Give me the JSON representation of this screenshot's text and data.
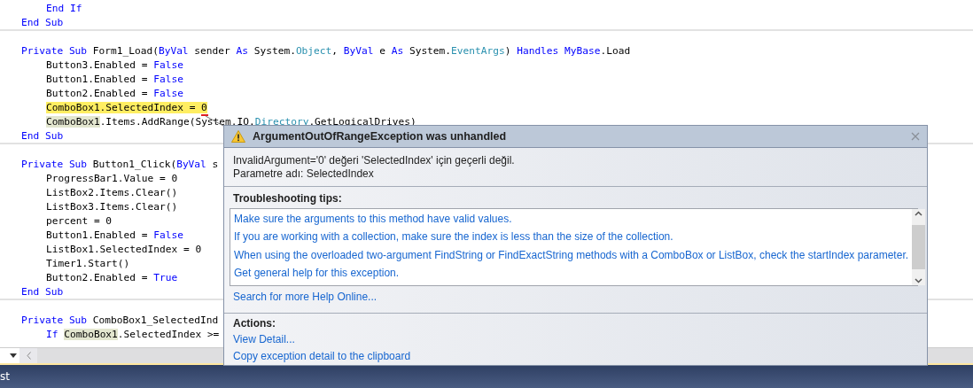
{
  "editor": {
    "lines": [
      {
        "kind": "code",
        "indented": true,
        "separator": false,
        "tokens": [
          {
            "text": "End If",
            "kind": "keyword"
          }
        ]
      },
      {
        "kind": "code",
        "indented": false,
        "separator": true,
        "tokens": [
          {
            "text": "End Sub",
            "kind": "keyword"
          }
        ]
      },
      {
        "kind": "blank"
      },
      {
        "kind": "code",
        "indented": false,
        "separator": false,
        "tokens": [
          {
            "text": "Private Sub",
            "kind": "keyword"
          },
          {
            "text": " Form1_Load(",
            "kind": "plain"
          },
          {
            "text": "ByVal",
            "kind": "keyword"
          },
          {
            "text": " sender ",
            "kind": "plain"
          },
          {
            "text": "As",
            "kind": "keyword"
          },
          {
            "text": " System.",
            "kind": "plain"
          },
          {
            "text": "Object",
            "kind": "type"
          },
          {
            "text": ", ",
            "kind": "plain"
          },
          {
            "text": "ByVal",
            "kind": "keyword"
          },
          {
            "text": " e ",
            "kind": "plain"
          },
          {
            "text": "As",
            "kind": "keyword"
          },
          {
            "text": " System.",
            "kind": "plain"
          },
          {
            "text": "EventArgs",
            "kind": "type"
          },
          {
            "text": ") ",
            "kind": "plain"
          },
          {
            "text": "Handles MyBase",
            "kind": "keyword"
          },
          {
            "text": ".Load",
            "kind": "plain"
          }
        ]
      },
      {
        "kind": "code",
        "indented": true,
        "separator": false,
        "tokens": [
          {
            "text": "Button3.Enabled = ",
            "kind": "plain"
          },
          {
            "text": "False",
            "kind": "keyword"
          }
        ]
      },
      {
        "kind": "code",
        "indented": true,
        "separator": false,
        "tokens": [
          {
            "text": "Button1.Enabled = ",
            "kind": "plain"
          },
          {
            "text": "False",
            "kind": "keyword"
          }
        ]
      },
      {
        "kind": "code",
        "indented": true,
        "separator": false,
        "tokens": [
          {
            "text": "Button2.Enabled = ",
            "kind": "plain"
          },
          {
            "text": "False",
            "kind": "keyword"
          }
        ]
      },
      {
        "kind": "code",
        "indented": true,
        "separator": false,
        "tokens": [
          {
            "text": "ComboBox1.SelectedIndex = 0",
            "kind": "current"
          }
        ]
      },
      {
        "kind": "code",
        "indented": true,
        "separator": false,
        "tokens": [
          {
            "text": "ComboBox1",
            "kind": "reference"
          },
          {
            "text": ".Items.AddRange(System.IO.",
            "kind": "plain"
          },
          {
            "text": "Directory",
            "kind": "type"
          },
          {
            "text": ".GetLogicalDrives)",
            "kind": "plain"
          }
        ]
      },
      {
        "kind": "code",
        "indented": false,
        "separator": true,
        "tokens": [
          {
            "text": "End Sub",
            "kind": "keyword"
          }
        ]
      },
      {
        "kind": "blank"
      },
      {
        "kind": "code",
        "indented": false,
        "separator": false,
        "tokens": [
          {
            "text": "Private Sub",
            "kind": "keyword"
          },
          {
            "text": " Button1_Click(",
            "kind": "plain"
          },
          {
            "text": "ByVal",
            "kind": "keyword"
          },
          {
            "text": " s",
            "kind": "plain"
          }
        ]
      },
      {
        "kind": "code",
        "indented": true,
        "separator": false,
        "tokens": [
          {
            "text": "ProgressBar1.Value = 0",
            "kind": "plain"
          }
        ]
      },
      {
        "kind": "code",
        "indented": true,
        "separator": false,
        "tokens": [
          {
            "text": "ListBox2.Items.Clear()",
            "kind": "plain"
          }
        ]
      },
      {
        "kind": "code",
        "indented": true,
        "separator": false,
        "tokens": [
          {
            "text": "ListBox3.Items.Clear()",
            "kind": "plain"
          }
        ]
      },
      {
        "kind": "code",
        "indented": true,
        "separator": false,
        "tokens": [
          {
            "text": "percent = 0",
            "kind": "plain"
          }
        ]
      },
      {
        "kind": "code",
        "indented": true,
        "separator": false,
        "tokens": [
          {
            "text": "Button1.Enabled = ",
            "kind": "plain"
          },
          {
            "text": "False",
            "kind": "keyword"
          }
        ]
      },
      {
        "kind": "code",
        "indented": true,
        "separator": false,
        "tokens": [
          {
            "text": "ListBox1.SelectedIndex = 0",
            "kind": "plain"
          }
        ]
      },
      {
        "kind": "code",
        "indented": true,
        "separator": false,
        "tokens": [
          {
            "text": "Timer1.Start()",
            "kind": "plain"
          }
        ]
      },
      {
        "kind": "code",
        "indented": true,
        "separator": false,
        "tokens": [
          {
            "text": "Button2.Enabled = ",
            "kind": "plain"
          },
          {
            "text": "True",
            "kind": "keyword"
          }
        ]
      },
      {
        "kind": "code",
        "indented": false,
        "separator": true,
        "tokens": [
          {
            "text": "End Sub",
            "kind": "keyword"
          }
        ]
      },
      {
        "kind": "blank"
      },
      {
        "kind": "code",
        "indented": false,
        "separator": false,
        "tokens": [
          {
            "text": "Private Sub",
            "kind": "keyword"
          },
          {
            "text": " ComboBox1_SelectedInd",
            "kind": "plain"
          }
        ]
      },
      {
        "kind": "code",
        "indented": true,
        "separator": false,
        "tokens": [
          {
            "text": "If ",
            "kind": "keyword"
          },
          {
            "text": "ComboBox1",
            "kind": "reference"
          },
          {
            "text": ".SelectedIndex >=",
            "kind": "plain"
          }
        ]
      }
    ]
  },
  "exception": {
    "title": "ArgumentOutOfRangeException was unhandled",
    "message": [
      "InvalidArgument='0' değeri 'SelectedIndex' için geçerli değil.",
      "Parametre adı: SelectedIndex"
    ],
    "tips_heading": "Troubleshooting tips:",
    "tips": [
      "Make sure the arguments to this method have valid values.",
      "If you are working with a collection, make sure the index is less than the size of the collection.",
      "When using the overloaded two-argument FindString or FindExactString methods with a ComboBox or ListBox, check the startIndex parameter.",
      "Get general help for this exception."
    ],
    "search_link": "Search for more Help Online...",
    "actions_heading": "Actions:",
    "actions": [
      "View Detail...",
      "Copy exception detail to the clipboard"
    ]
  },
  "status_bar": {
    "text": "st"
  }
}
